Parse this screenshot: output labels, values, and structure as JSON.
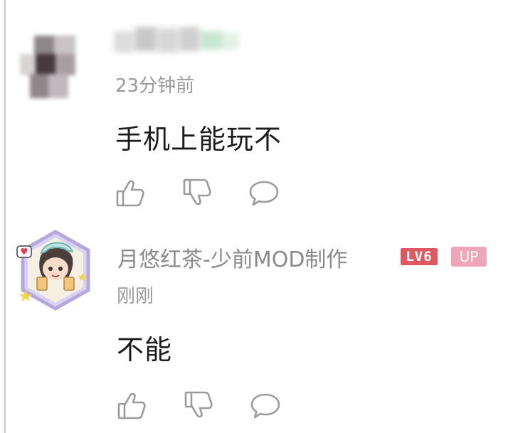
{
  "comments": [
    {
      "username": "",
      "time": "23分钟前",
      "content": "手机上能玩不",
      "actions": {
        "like": "thumbs-up-icon",
        "dislike": "thumbs-down-icon",
        "reply": "comment-bubble-icon"
      }
    },
    {
      "username": "月悠红茶-少前MOD制作",
      "level_badge": "LV6",
      "up_badge": "UP",
      "time": "刚刚",
      "content": "不能",
      "actions": {
        "like": "thumbs-up-icon",
        "dislike": "thumbs-down-icon",
        "reply": "comment-bubble-icon"
      }
    }
  ],
  "colors": {
    "text_primary": "#1c1c1c",
    "text_secondary": "#9a9a9a",
    "icon_stroke": "#9b9b9b",
    "level_badge": "#e0585f",
    "up_badge": "#f0a6b9"
  }
}
